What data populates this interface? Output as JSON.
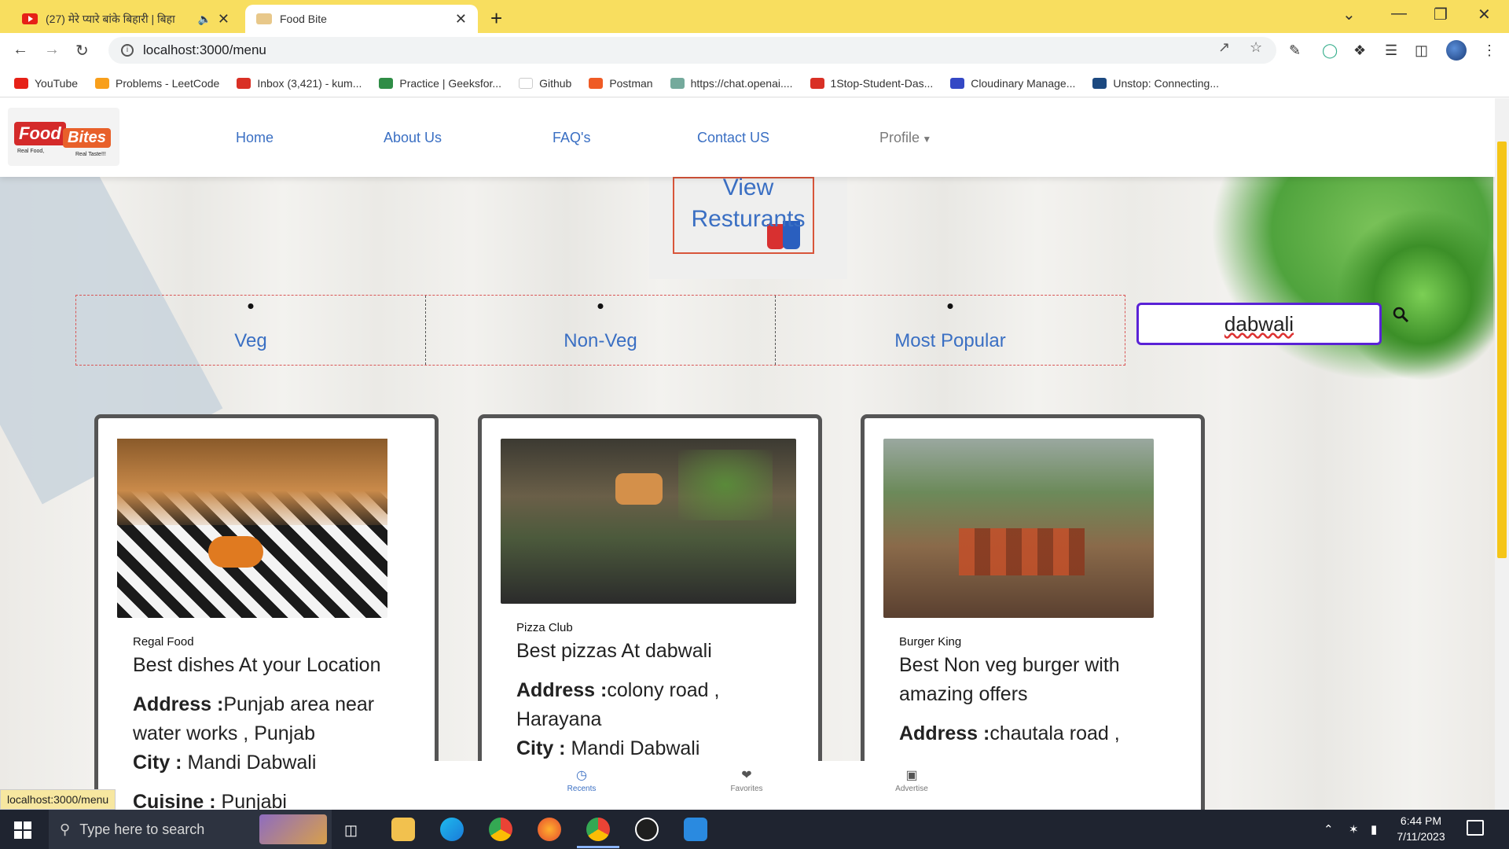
{
  "browser": {
    "tabs": [
      {
        "title": "(27) मेरे प्यारे बांके बिहारी | बिहा",
        "active": false
      },
      {
        "title": "Food Bite",
        "active": true
      }
    ],
    "url": "localhost:3000/menu",
    "bookmarks": [
      {
        "label": "YouTube",
        "icon": "youtube-icon",
        "color": "#e62117"
      },
      {
        "label": "Problems - LeetCode",
        "icon": "leetcode-icon",
        "color": "#f89f1b"
      },
      {
        "label": "Inbox (3,421) - kum...",
        "icon": "gmail-icon",
        "color": "#d93025"
      },
      {
        "label": "Practice | Geeksfor...",
        "icon": "geeksforgeeks-icon",
        "color": "#2f8d46"
      },
      {
        "label": "Github",
        "icon": "github-icon",
        "color": "#ffffff"
      },
      {
        "label": "Postman",
        "icon": "postman-icon",
        "color": "#ef5b25"
      },
      {
        "label": "https://chat.openai....",
        "icon": "openai-icon",
        "color": "#74aa9c"
      },
      {
        "label": "1Stop-Student-Das...",
        "icon": "onestop-icon",
        "color": "#d93025"
      },
      {
        "label": "Cloudinary Manage...",
        "icon": "cloudinary-icon",
        "color": "#3448c5"
      },
      {
        "label": "Unstop: Connecting...",
        "icon": "unstop-icon",
        "color": "#1c4980"
      }
    ],
    "status_url": "localhost:3000/menu"
  },
  "site": {
    "logo": {
      "word1": "Food",
      "word2": "Bites",
      "tag1": "Real Food,",
      "tag2": "Real Taste!!!"
    },
    "nav": [
      "Home",
      "About Us",
      "FAQ's",
      "Contact US",
      "Profile"
    ],
    "hero_title": "View Resturants",
    "filters": [
      "Veg",
      "Non-Veg",
      "Most Popular"
    ],
    "search_value": "dabwali",
    "cards": [
      {
        "name": "Regal Food",
        "title": "Best dishes At your Location",
        "address_label": "Address :",
        "address": "Punjab area near water works , Punjab",
        "city_label": "City :",
        "city": "Mandi Dabwali",
        "extra_label": "Cuisine :",
        "extra": "Punjabi"
      },
      {
        "name": "Pizza Club",
        "title": "Best pizzas At dabwali",
        "address_label": "Address :",
        "address": "colony road , Harayana",
        "city_label": "City :",
        "city": "Mandi Dabwali"
      },
      {
        "name": "Burger King",
        "title": "Best Non veg burger with amazing offers",
        "address_label": "Address :",
        "address": "chautala road ,"
      }
    ],
    "bottom_nav": [
      {
        "label": "Recents",
        "icon": "clock-icon",
        "active": true
      },
      {
        "label": "Favorites",
        "icon": "heart-icon",
        "active": false
      },
      {
        "label": "Advertise",
        "icon": "archive-icon",
        "active": false
      }
    ]
  },
  "taskbar": {
    "search_placeholder": "Type here to search",
    "time": "6:44 PM",
    "date": "7/11/2023"
  }
}
